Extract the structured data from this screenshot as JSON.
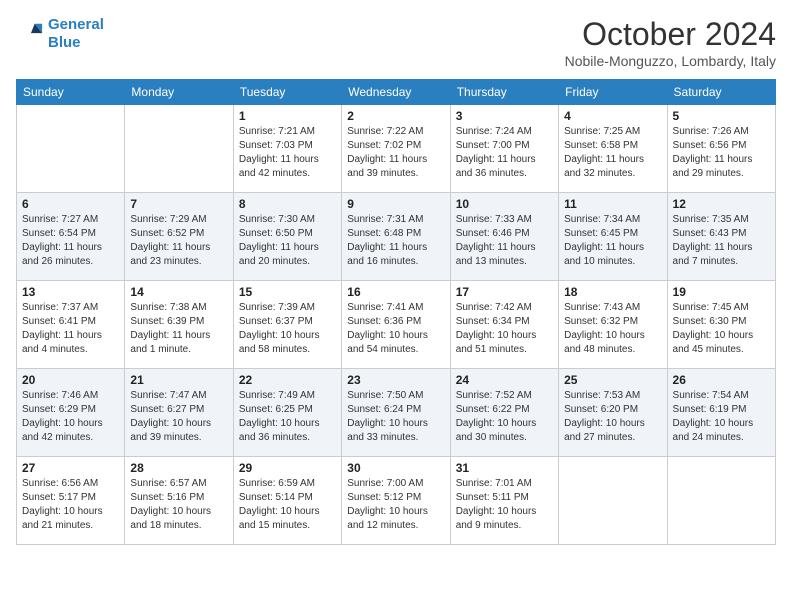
{
  "logo": {
    "line1": "General",
    "line2": "Blue"
  },
  "title": "October 2024",
  "subtitle": "Nobile-Monguzzo, Lombardy, Italy",
  "days_of_week": [
    "Sunday",
    "Monday",
    "Tuesday",
    "Wednesday",
    "Thursday",
    "Friday",
    "Saturday"
  ],
  "weeks": [
    [
      {
        "day": "",
        "info": ""
      },
      {
        "day": "",
        "info": ""
      },
      {
        "day": "1",
        "info": "Sunrise: 7:21 AM\nSunset: 7:03 PM\nDaylight: 11 hours and 42 minutes."
      },
      {
        "day": "2",
        "info": "Sunrise: 7:22 AM\nSunset: 7:02 PM\nDaylight: 11 hours and 39 minutes."
      },
      {
        "day": "3",
        "info": "Sunrise: 7:24 AM\nSunset: 7:00 PM\nDaylight: 11 hours and 36 minutes."
      },
      {
        "day": "4",
        "info": "Sunrise: 7:25 AM\nSunset: 6:58 PM\nDaylight: 11 hours and 32 minutes."
      },
      {
        "day": "5",
        "info": "Sunrise: 7:26 AM\nSunset: 6:56 PM\nDaylight: 11 hours and 29 minutes."
      }
    ],
    [
      {
        "day": "6",
        "info": "Sunrise: 7:27 AM\nSunset: 6:54 PM\nDaylight: 11 hours and 26 minutes."
      },
      {
        "day": "7",
        "info": "Sunrise: 7:29 AM\nSunset: 6:52 PM\nDaylight: 11 hours and 23 minutes."
      },
      {
        "day": "8",
        "info": "Sunrise: 7:30 AM\nSunset: 6:50 PM\nDaylight: 11 hours and 20 minutes."
      },
      {
        "day": "9",
        "info": "Sunrise: 7:31 AM\nSunset: 6:48 PM\nDaylight: 11 hours and 16 minutes."
      },
      {
        "day": "10",
        "info": "Sunrise: 7:33 AM\nSunset: 6:46 PM\nDaylight: 11 hours and 13 minutes."
      },
      {
        "day": "11",
        "info": "Sunrise: 7:34 AM\nSunset: 6:45 PM\nDaylight: 11 hours and 10 minutes."
      },
      {
        "day": "12",
        "info": "Sunrise: 7:35 AM\nSunset: 6:43 PM\nDaylight: 11 hours and 7 minutes."
      }
    ],
    [
      {
        "day": "13",
        "info": "Sunrise: 7:37 AM\nSunset: 6:41 PM\nDaylight: 11 hours and 4 minutes."
      },
      {
        "day": "14",
        "info": "Sunrise: 7:38 AM\nSunset: 6:39 PM\nDaylight: 11 hours and 1 minute."
      },
      {
        "day": "15",
        "info": "Sunrise: 7:39 AM\nSunset: 6:37 PM\nDaylight: 10 hours and 58 minutes."
      },
      {
        "day": "16",
        "info": "Sunrise: 7:41 AM\nSunset: 6:36 PM\nDaylight: 10 hours and 54 minutes."
      },
      {
        "day": "17",
        "info": "Sunrise: 7:42 AM\nSunset: 6:34 PM\nDaylight: 10 hours and 51 minutes."
      },
      {
        "day": "18",
        "info": "Sunrise: 7:43 AM\nSunset: 6:32 PM\nDaylight: 10 hours and 48 minutes."
      },
      {
        "day": "19",
        "info": "Sunrise: 7:45 AM\nSunset: 6:30 PM\nDaylight: 10 hours and 45 minutes."
      }
    ],
    [
      {
        "day": "20",
        "info": "Sunrise: 7:46 AM\nSunset: 6:29 PM\nDaylight: 10 hours and 42 minutes."
      },
      {
        "day": "21",
        "info": "Sunrise: 7:47 AM\nSunset: 6:27 PM\nDaylight: 10 hours and 39 minutes."
      },
      {
        "day": "22",
        "info": "Sunrise: 7:49 AM\nSunset: 6:25 PM\nDaylight: 10 hours and 36 minutes."
      },
      {
        "day": "23",
        "info": "Sunrise: 7:50 AM\nSunset: 6:24 PM\nDaylight: 10 hours and 33 minutes."
      },
      {
        "day": "24",
        "info": "Sunrise: 7:52 AM\nSunset: 6:22 PM\nDaylight: 10 hours and 30 minutes."
      },
      {
        "day": "25",
        "info": "Sunrise: 7:53 AM\nSunset: 6:20 PM\nDaylight: 10 hours and 27 minutes."
      },
      {
        "day": "26",
        "info": "Sunrise: 7:54 AM\nSunset: 6:19 PM\nDaylight: 10 hours and 24 minutes."
      }
    ],
    [
      {
        "day": "27",
        "info": "Sunrise: 6:56 AM\nSunset: 5:17 PM\nDaylight: 10 hours and 21 minutes."
      },
      {
        "day": "28",
        "info": "Sunrise: 6:57 AM\nSunset: 5:16 PM\nDaylight: 10 hours and 18 minutes."
      },
      {
        "day": "29",
        "info": "Sunrise: 6:59 AM\nSunset: 5:14 PM\nDaylight: 10 hours and 15 minutes."
      },
      {
        "day": "30",
        "info": "Sunrise: 7:00 AM\nSunset: 5:12 PM\nDaylight: 10 hours and 12 minutes."
      },
      {
        "day": "31",
        "info": "Sunrise: 7:01 AM\nSunset: 5:11 PM\nDaylight: 10 hours and 9 minutes."
      },
      {
        "day": "",
        "info": ""
      },
      {
        "day": "",
        "info": ""
      }
    ]
  ]
}
